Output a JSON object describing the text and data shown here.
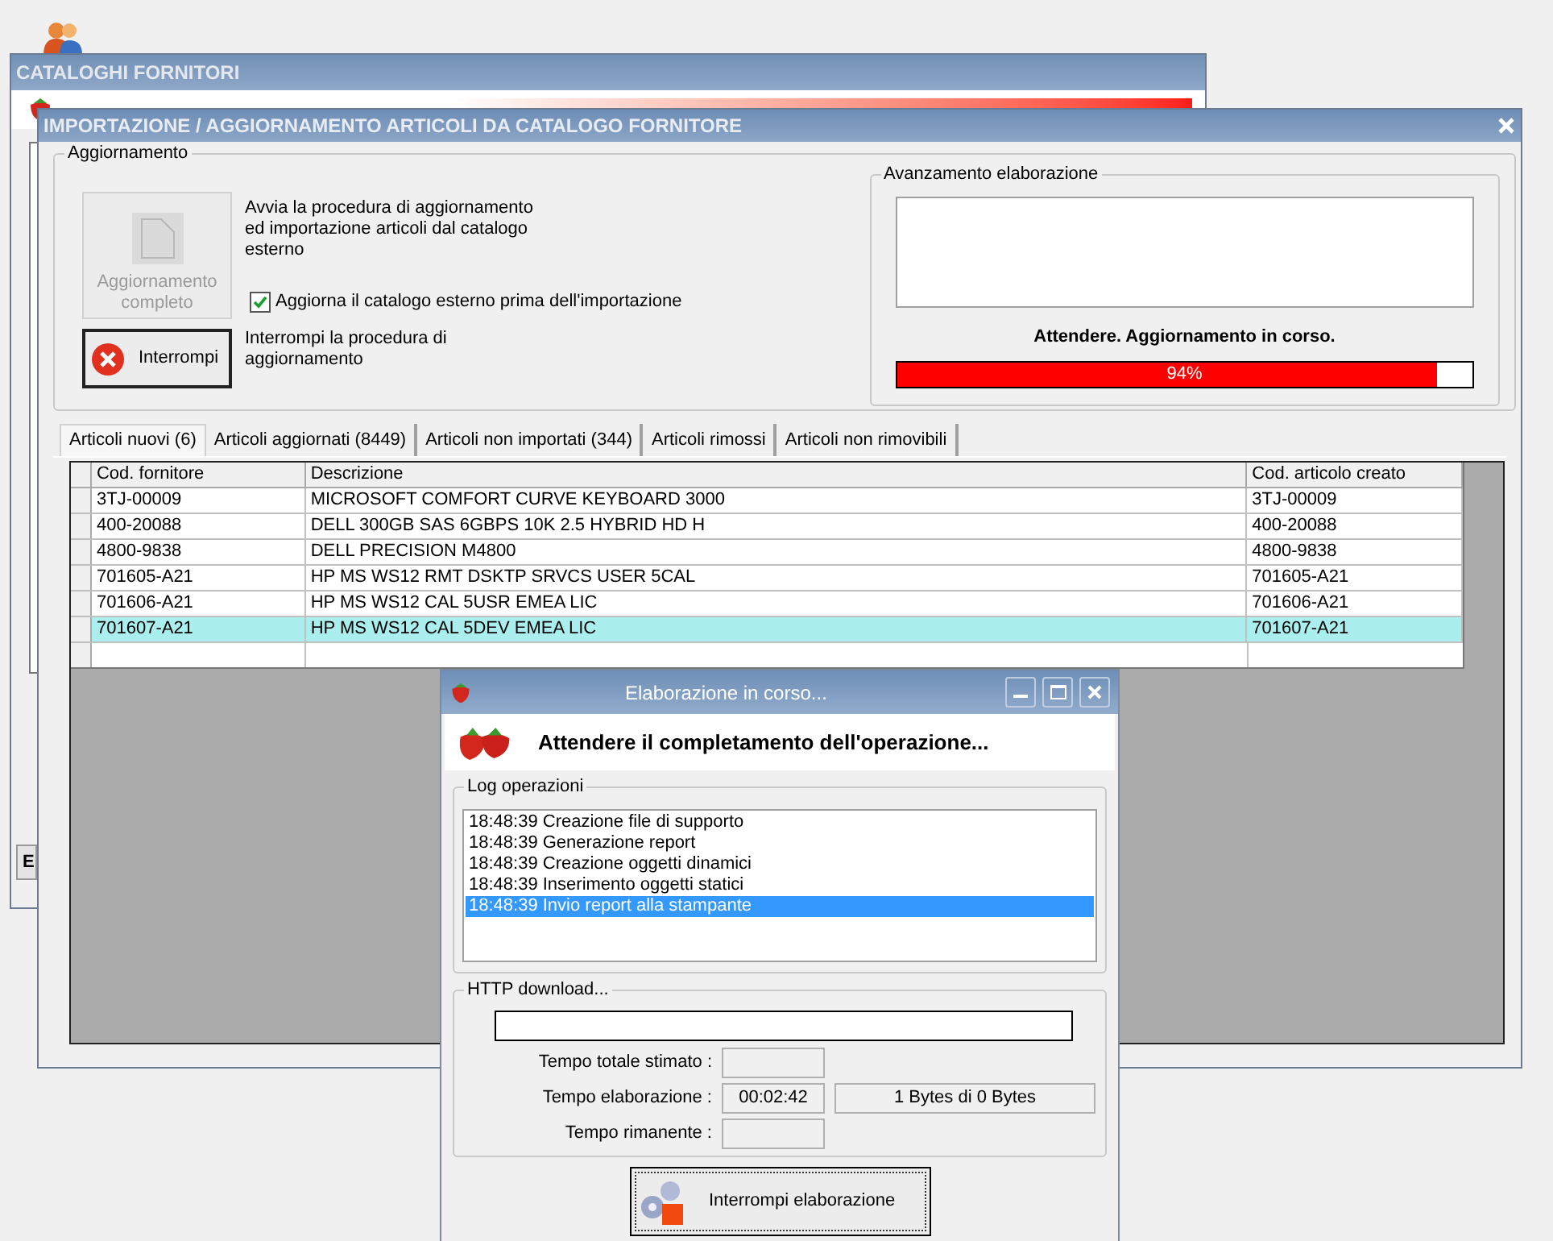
{
  "back_window": {
    "title": "CATALOGHI FORNITORI",
    "side_button": "E"
  },
  "main_window": {
    "title": "IMPORTAZIONE / AGGIORNAMENTO ARTICOLI DA CATALOGO FORNITORE",
    "update_group": {
      "title": "Aggiornamento",
      "full_update_button": {
        "label": "Aggiornamento completo",
        "disabled": true
      },
      "full_update_description": "Avvia la procedura di aggiornamento ed importazione articoli dal catalogo esterno",
      "refresh_checkbox": {
        "label": "Aggiorna il catalogo esterno prima dell'importazione",
        "checked": true
      },
      "stop_button": "Interrompi",
      "stop_description": "Interrompi la procedura di aggiornamento"
    },
    "progress_group": {
      "title": "Avanzamento elaborazione",
      "status": "Attendere. Aggiornamento in corso.",
      "progress": {
        "level": 0.94,
        "reading": "94%"
      }
    },
    "tabs": [
      {
        "label": "Articoli nuovi (6)",
        "selected": true
      },
      {
        "label": "Articoli aggiornati (8449)",
        "selected": false
      },
      {
        "label": "Articoli non importati (344)",
        "selected": false
      },
      {
        "label": "Articoli rimossi",
        "selected": false
      },
      {
        "label": "Articoli non rimovibili",
        "selected": false
      }
    ],
    "table": {
      "columns": [
        "Cod. fornitore",
        "Descrizione",
        "Cod. articolo creato"
      ],
      "rows": [
        {
          "cells": [
            "3TJ-00009",
            "MICROSOFT COMFORT CURVE KEYBOARD 3000",
            "3TJ-00009"
          ],
          "selected": false
        },
        {
          "cells": [
            "400-20088",
            "DELL 300GB SAS 6GBPS 10K 2.5 HYBRID HD H",
            "400-20088"
          ],
          "selected": false
        },
        {
          "cells": [
            "4800-9838",
            "DELL PRECISION M4800",
            "4800-9838"
          ],
          "selected": false
        },
        {
          "cells": [
            "701605-A21",
            "HP MS WS12 RMT DSKTP SRVCS USER 5CAL",
            "701605-A21"
          ],
          "selected": false
        },
        {
          "cells": [
            "701606-A21",
            "HP MS WS12 CAL 5USR EMEA LIC",
            "701606-A21"
          ],
          "selected": false
        },
        {
          "cells": [
            "701607-A21",
            "HP MS WS12 CAL 5DEV EMEA LIC",
            "701607-A21"
          ],
          "selected": true
        }
      ]
    }
  },
  "dialog": {
    "title": "Elaborazione in corso...",
    "heading": "Attendere il completamento dell'operazione...",
    "log": {
      "title": "Log operazioni",
      "entries": [
        {
          "text": "18:48:39 Creazione file di supporto",
          "selected": false
        },
        {
          "text": "18:48:39 Generazione report",
          "selected": false
        },
        {
          "text": "18:48:39 Creazione oggetti dinamici",
          "selected": false
        },
        {
          "text": "18:48:39 Inserimento oggetti statici",
          "selected": false
        },
        {
          "text": "18:48:39 Invio report alla stampante",
          "selected": true
        }
      ]
    },
    "http": {
      "title": "HTTP download...",
      "fields": [
        {
          "label": "Tempo totale stimato :"
        },
        {
          "label": "Tempo elaborazione :",
          "value": "00:02:42"
        },
        {
          "label": "Tempo rimanente :"
        }
      ],
      "transfer": "1 Bytes di 0 Bytes"
    },
    "stop_button": "Interrompi elaborazione"
  }
}
